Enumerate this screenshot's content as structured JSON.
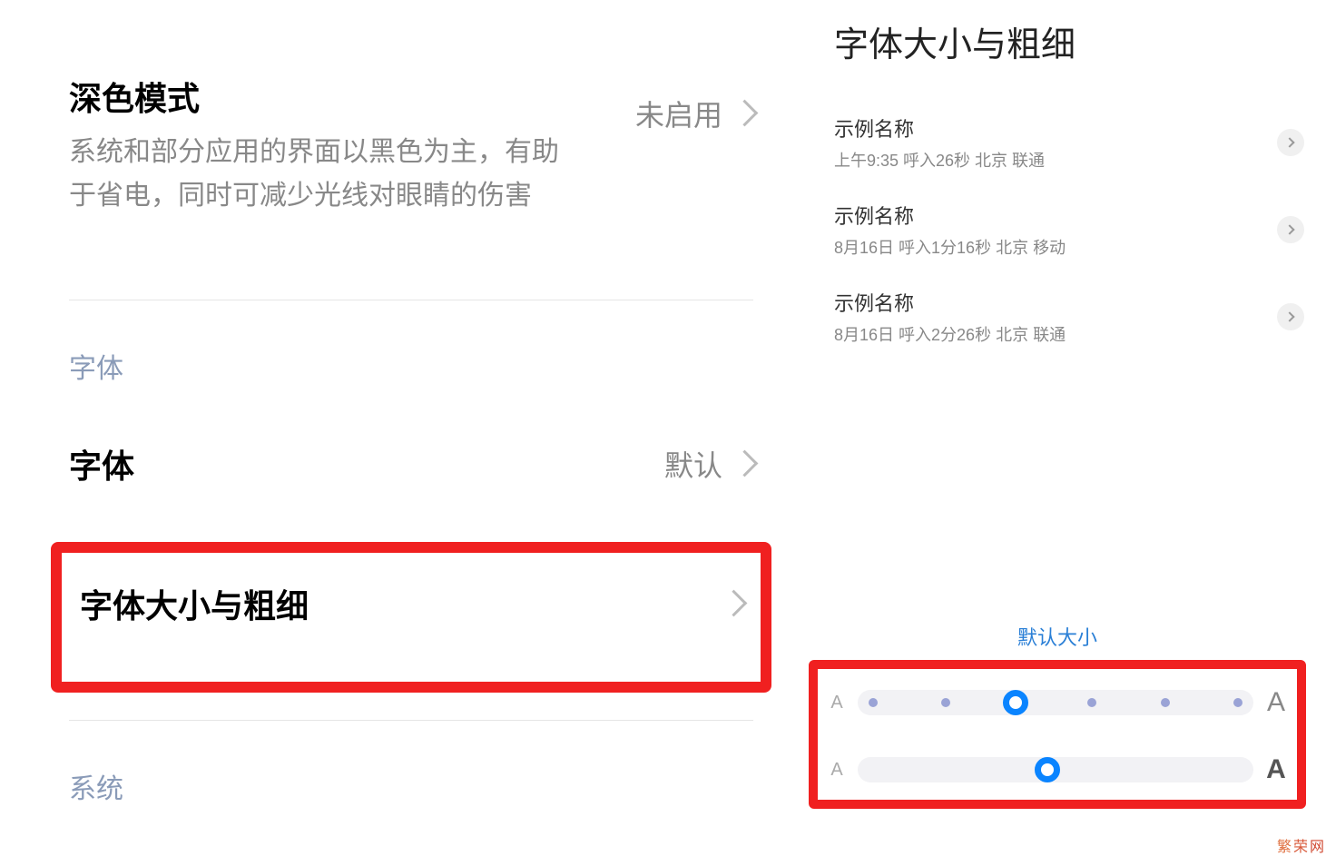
{
  "left": {
    "dark_mode": {
      "title": "深色模式",
      "desc": "系统和部分应用的界面以黑色为主，有助于省电，同时可减少光线对眼睛的伤害",
      "value": "未启用"
    },
    "section_font": "字体",
    "font": {
      "title": "字体",
      "value": "默认"
    },
    "font_size_weight": {
      "title": "字体大小与粗细"
    },
    "section_system": "系统"
  },
  "right": {
    "title": "字体大小与粗细",
    "samples": [
      {
        "title": "示例名称",
        "sub": "上午9:35 呼入26秒 北京 联通"
      },
      {
        "title": "示例名称",
        "sub": "8月16日 呼入1分16秒 北京 移动"
      },
      {
        "title": "示例名称",
        "sub": "8月16日 呼入2分26秒 北京 联通"
      }
    ],
    "default_label": "默认大小",
    "letter_small": "A",
    "letter_large": "A"
  },
  "watermark": "繁荣网"
}
